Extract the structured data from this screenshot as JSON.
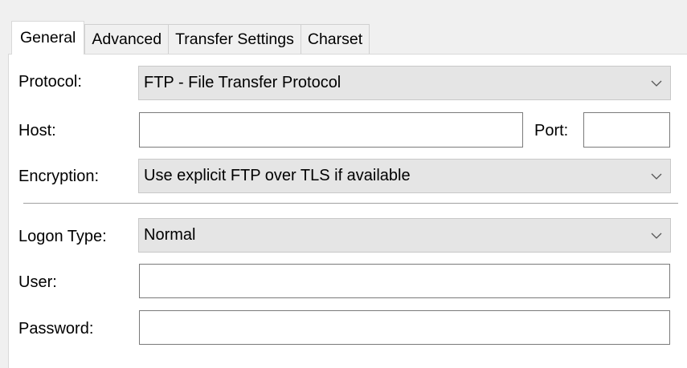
{
  "tabs": [
    {
      "label": "General",
      "active": true
    },
    {
      "label": "Advanced",
      "active": false
    },
    {
      "label": "Transfer Settings",
      "active": false
    },
    {
      "label": "Charset",
      "active": false
    }
  ],
  "form": {
    "protocol": {
      "label": "Protocol:",
      "value": "FTP - File Transfer Protocol"
    },
    "host": {
      "label": "Host:",
      "value": ""
    },
    "port": {
      "label": "Port:",
      "value": ""
    },
    "encryption": {
      "label": "Encryption:",
      "value": "Use explicit FTP over TLS if available"
    },
    "logon_type": {
      "label": "Logon Type:",
      "value": "Normal"
    },
    "user": {
      "label": "User:",
      "value": ""
    },
    "password": {
      "label": "Password:",
      "value": ""
    }
  },
  "icons": {
    "dropdown": "chevron-down-icon"
  },
  "colors": {
    "panel_bg": "#ffffff",
    "window_bg": "#f0f0f0",
    "select_bg": "#e5e5e5",
    "input_border": "#7a7a7a"
  }
}
